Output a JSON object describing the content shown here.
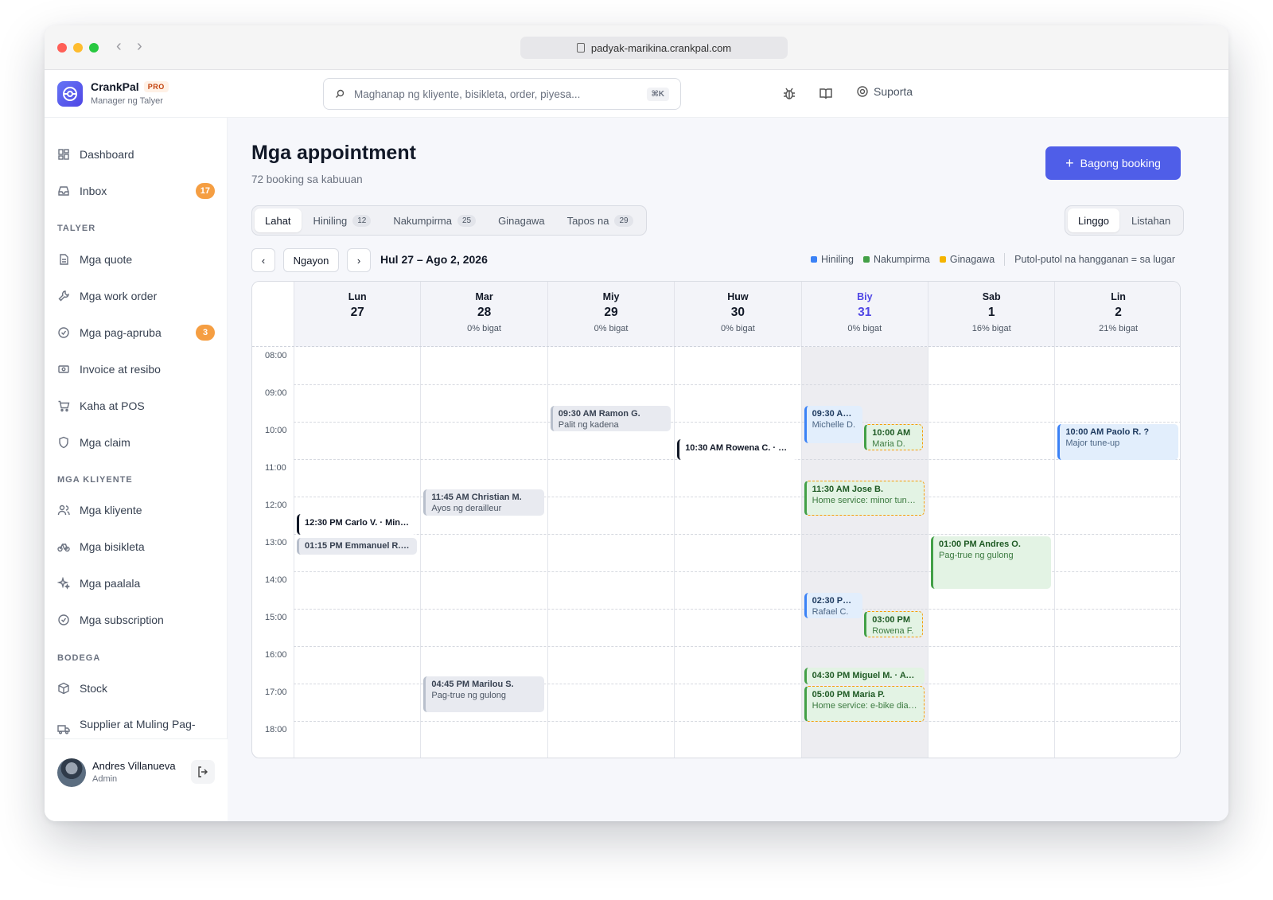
{
  "browser": {
    "url": "padyak-marikina.crankpal.com"
  },
  "app": {
    "name": "CrankPal",
    "badge": "PRO",
    "subtitle": "Manager ng Talyer"
  },
  "search": {
    "placeholder": "Maghanap ng kliyente, bisikleta, order, piyesa...",
    "shortcut": "⌘K"
  },
  "header": {
    "support_label": "Suporta"
  },
  "sidebar": {
    "top": [
      {
        "label": "Dashboard",
        "icon": "grid-icon"
      },
      {
        "label": "Inbox",
        "icon": "inbox-icon",
        "badge": "17"
      }
    ],
    "sections": [
      {
        "title": "TALYER",
        "items": [
          {
            "label": "Mga quote",
            "icon": "document-icon"
          },
          {
            "label": "Mga work order",
            "icon": "wrench-icon"
          },
          {
            "label": "Mga pag-apruba",
            "icon": "check-circle-icon",
            "badge": "3"
          },
          {
            "label": "Invoice at resibo",
            "icon": "cash-icon"
          },
          {
            "label": "Kaha at POS",
            "icon": "cart-icon"
          },
          {
            "label": "Mga claim",
            "icon": "shield-icon"
          }
        ]
      },
      {
        "title": "MGA KLIYENTE",
        "items": [
          {
            "label": "Mga kliyente",
            "icon": "users-icon"
          },
          {
            "label": "Mga bisikleta",
            "icon": "bicycle-icon"
          },
          {
            "label": "Mga paalala",
            "icon": "sparkle-icon"
          },
          {
            "label": "Mga subscription",
            "icon": "check-circle-icon"
          }
        ]
      },
      {
        "title": "BODEGA",
        "items": [
          {
            "label": "Stock",
            "icon": "box-icon"
          },
          {
            "label": "Supplier at Muling Pag-",
            "icon": "truck-icon"
          }
        ]
      }
    ],
    "user": {
      "name": "Andres Villanueva",
      "role": "Admin"
    }
  },
  "page": {
    "title": "Mga appointment",
    "subtitle": "72 booking sa kabuuan",
    "new_button": "Bagong booking",
    "tabs": [
      {
        "label": "Lahat",
        "count": null,
        "active": true
      },
      {
        "label": "Hiniling",
        "count": "12"
      },
      {
        "label": "Nakumpirma",
        "count": "25"
      },
      {
        "label": "Ginagawa",
        "count": null
      },
      {
        "label": "Tapos na",
        "count": "29"
      }
    ],
    "views": [
      {
        "label": "Linggo",
        "active": true
      },
      {
        "label": "Listahan"
      }
    ],
    "nav": {
      "prev": "‹",
      "today": "Ngayon",
      "next": "›"
    },
    "date_range": "Hul 27 – Ago 2, 2026",
    "legend": [
      {
        "label": "Hiniling",
        "color": "#3b82f6"
      },
      {
        "label": "Nakumpirma",
        "color": "#43a047"
      },
      {
        "label": "Ginagawa",
        "color": "#f5b400"
      }
    ],
    "legend_note": "Putol-putol na hangganan = sa lugar"
  },
  "calendar": {
    "hours": [
      "08:00",
      "09:00",
      "10:00",
      "11:00",
      "12:00",
      "13:00",
      "14:00",
      "15:00",
      "16:00",
      "17:00",
      "18:00"
    ],
    "days": [
      {
        "name": "Lun",
        "date": "27",
        "load": ""
      },
      {
        "name": "Mar",
        "date": "28",
        "load": "0% bigat"
      },
      {
        "name": "Miy",
        "date": "29",
        "load": "0% bigat"
      },
      {
        "name": "Huw",
        "date": "30",
        "load": "0% bigat"
      },
      {
        "name": "Biy",
        "date": "31",
        "load": "0% bigat",
        "today": true
      },
      {
        "name": "Sab",
        "date": "1",
        "load": "16% bigat"
      },
      {
        "name": "Lin",
        "date": "2",
        "load": "21% bigat"
      }
    ],
    "events": [
      {
        "day": 2,
        "start": 9.5,
        "end": 10.2,
        "lane": 0,
        "lanes": 1,
        "status": "gray",
        "title": "09:30 AM Ramon G.",
        "sub": "Palit ng kadena"
      },
      {
        "day": 3,
        "start": 10.4,
        "end": 10.95,
        "lane": 0,
        "lanes": 1,
        "status": "plain",
        "title": "10:30 AM Rowena C. · Pa...",
        "sub": ""
      },
      {
        "day": 4,
        "start": 9.5,
        "end": 10.5,
        "lane": 0,
        "lanes": 2,
        "status": "blue",
        "title": "09:30 AM ?",
        "sub": "Michelle D."
      },
      {
        "day": 4,
        "start": 10.0,
        "end": 10.7,
        "lane": 1,
        "lanes": 2,
        "status": "green",
        "title": "10:00 AM",
        "sub": "Maria D."
      },
      {
        "day": 4,
        "start": 11.5,
        "end": 12.45,
        "lane": 0,
        "lanes": 1,
        "status": "green",
        "title": "11:30 AM Jose B.",
        "sub": "Home service: minor tune-..."
      },
      {
        "day": 6,
        "start": 10.0,
        "end": 10.95,
        "lane": 0,
        "lanes": 1,
        "status": "blue",
        "title": "10:00 AM Paolo R. ?",
        "sub": "Major tune-up"
      },
      {
        "day": 1,
        "start": 11.75,
        "end": 12.45,
        "lane": 0,
        "lanes": 1,
        "status": "gray",
        "title": "11:45 AM Christian M.",
        "sub": "Ayos ng derailleur"
      },
      {
        "day": 0,
        "start": 12.4,
        "end": 12.95,
        "lane": 0,
        "lanes": 1,
        "status": "plain",
        "title": "12:30 PM Carlo V. · Minor...",
        "sub": ""
      },
      {
        "day": 0,
        "start": 13.05,
        "end": 13.5,
        "lane": 0,
        "lanes": 1,
        "status": "gray",
        "title": "01:15 PM Emmanuel R. · ...",
        "sub": ""
      },
      {
        "day": 5,
        "start": 13.0,
        "end": 14.4,
        "lane": 0,
        "lanes": 1,
        "status": "green solid",
        "title": "01:00 PM Andres O.",
        "sub": "Pag-true ng gulong"
      },
      {
        "day": 4,
        "start": 14.5,
        "end": 15.2,
        "lane": 0,
        "lanes": 2,
        "status": "blue",
        "title": "02:30 PM ?",
        "sub": "Rafael C."
      },
      {
        "day": 4,
        "start": 15.0,
        "end": 15.7,
        "lane": 1,
        "lanes": 2,
        "status": "green",
        "title": "03:00 PM",
        "sub": "Rowena F."
      },
      {
        "day": 1,
        "start": 16.75,
        "end": 17.7,
        "lane": 0,
        "lanes": 1,
        "status": "gray",
        "title": "04:45 PM Marilou S.",
        "sub": "Pag-true ng gulong"
      },
      {
        "day": 4,
        "start": 16.5,
        "end": 16.95,
        "lane": 0,
        "lanes": 1,
        "status": "green solid",
        "title": "04:30 PM Miguel M. · Ayo...",
        "sub": ""
      },
      {
        "day": 4,
        "start": 17.0,
        "end": 17.95,
        "lane": 0,
        "lanes": 1,
        "status": "green",
        "title": "05:00 PM Maria P.",
        "sub": "Home service: e-bike diag..."
      }
    ]
  }
}
